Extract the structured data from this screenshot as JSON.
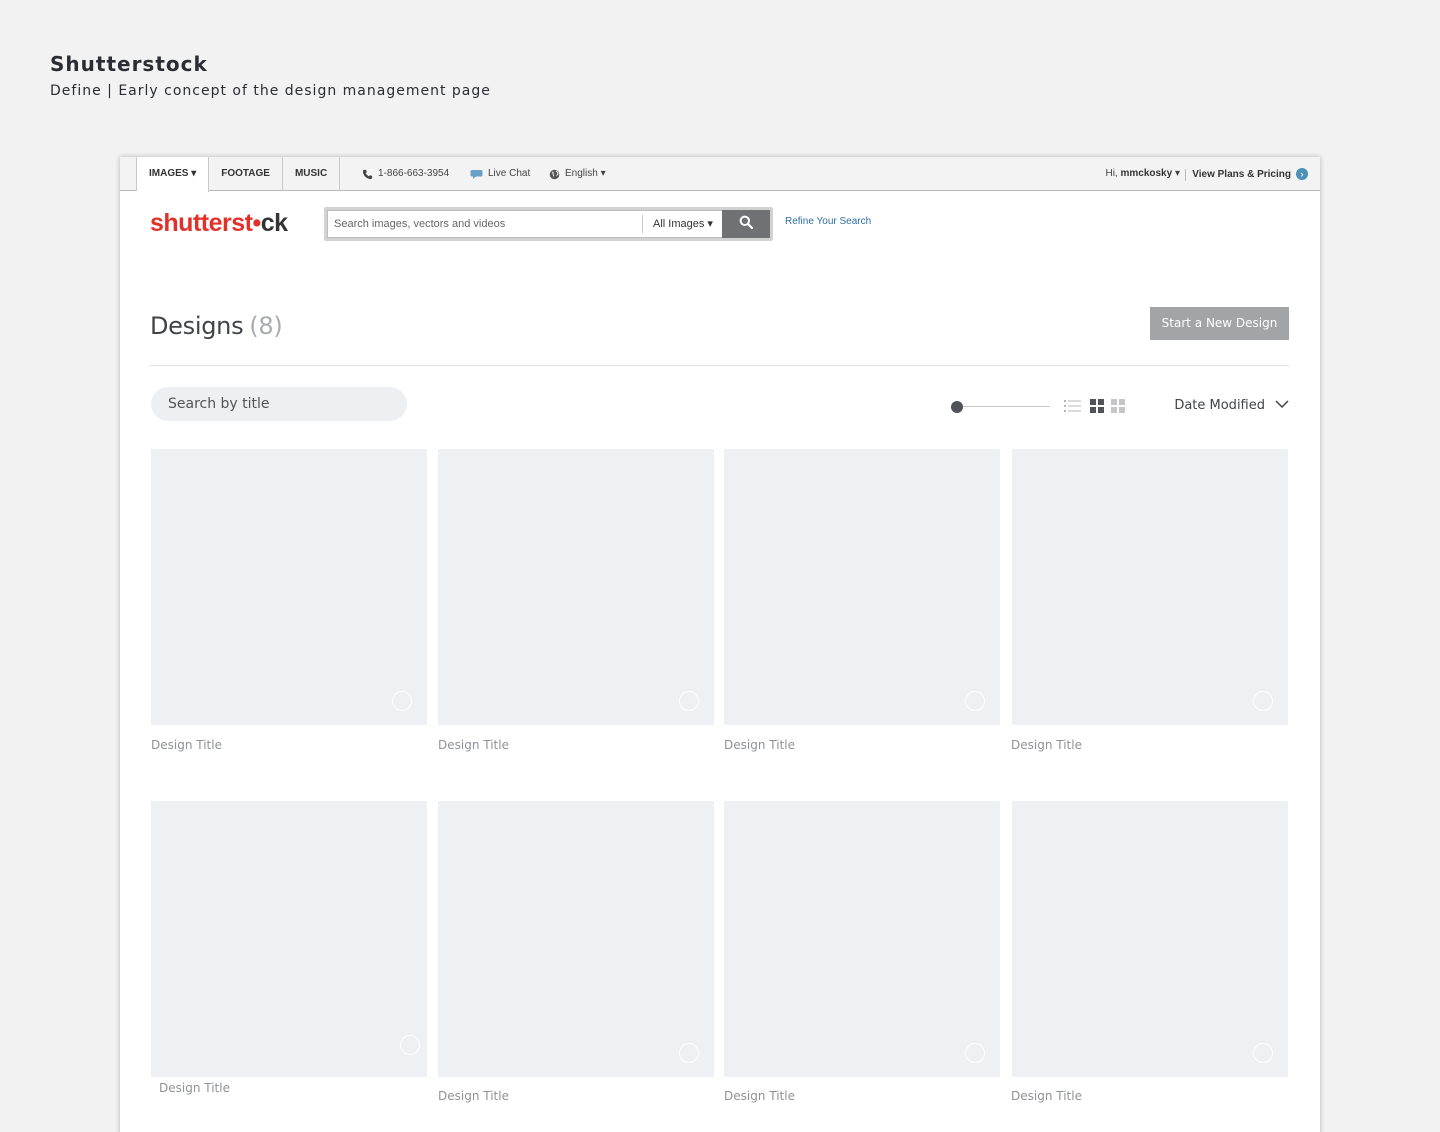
{
  "caption": {
    "title": "Shutterstock",
    "subtitle": "Define | Early concept of the design management page"
  },
  "topbar": {
    "tabs": [
      {
        "label": "IMAGES ▾"
      },
      {
        "label": "FOOTAGE"
      },
      {
        "label": "MUSIC"
      }
    ],
    "phone": "1-866-663-3954",
    "chat": "Live Chat",
    "language": "English ▾",
    "greeting_prefix": "Hi, ",
    "username": "mmckosky",
    "greeting_suffix": " ▾",
    "plans": "View Plans & Pricing"
  },
  "header": {
    "logo_part1": "shutterst",
    "logo_part2": "•",
    "logo_part3": "ck",
    "search_placeholder": "Search images, vectors and videos",
    "search_type": "All Images ▾",
    "refine": "Refine Your Search"
  },
  "page": {
    "title": "Designs",
    "count": "(8)",
    "new_button": "Start a New Design",
    "title_search_placeholder": "Search by title",
    "sort": "Date Modified",
    "thumbnail_size": 0
  },
  "designs": [
    {
      "title": "Design Title"
    },
    {
      "title": "Design Title"
    },
    {
      "title": "Design Title"
    },
    {
      "title": "Design Title"
    },
    {
      "title": "Design Title"
    },
    {
      "title": "Design Title"
    },
    {
      "title": "Design Title"
    },
    {
      "title": "Design Title"
    }
  ],
  "colors": {
    "brand_red": "#e0322a",
    "page_bg": "#f2f2f2",
    "card_bg": "#eff0f3",
    "button_grey": "#a3a4a6"
  }
}
